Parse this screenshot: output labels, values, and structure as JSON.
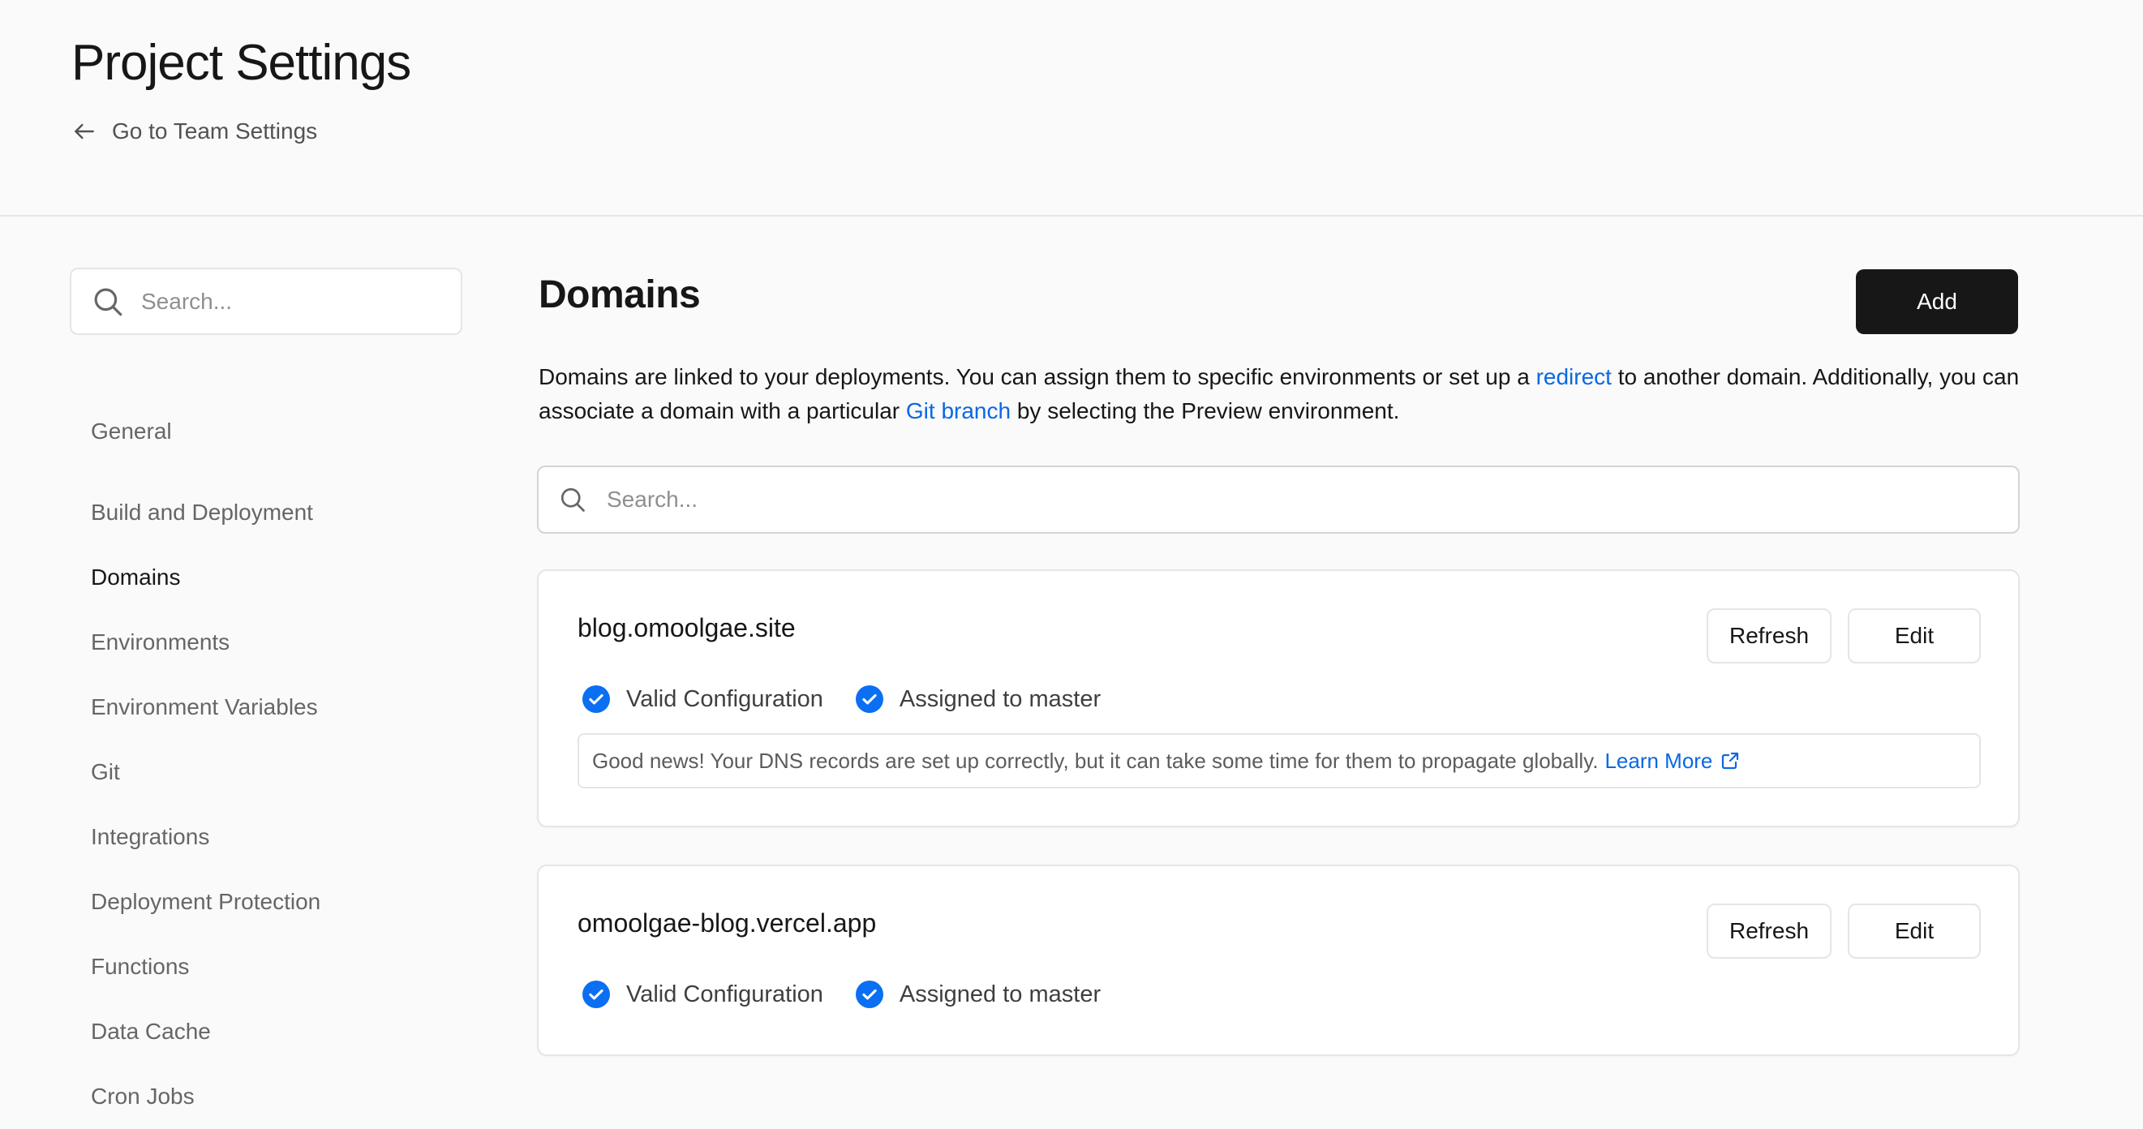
{
  "header": {
    "title": "Project Settings",
    "back_link": "Go to Team Settings"
  },
  "sidebar": {
    "search_placeholder": "Search...",
    "items": [
      {
        "label": "General"
      },
      {
        "label": "Build and Deployment"
      },
      {
        "label": "Domains",
        "active": true
      },
      {
        "label": "Environments"
      },
      {
        "label": "Environment Variables"
      },
      {
        "label": "Git"
      },
      {
        "label": "Integrations"
      },
      {
        "label": "Deployment Protection"
      },
      {
        "label": "Functions"
      },
      {
        "label": "Data Cache"
      },
      {
        "label": "Cron Jobs"
      }
    ]
  },
  "main": {
    "title": "Domains",
    "add_label": "Add",
    "description": {
      "part1": "Domains are linked to your deployments. You can assign them to specific environments or set up a ",
      "link1": "redirect",
      "part2": " to another domain. Additionally, you can associate a domain with a particular ",
      "link2": "Git branch",
      "part3": " by selecting the Preview environment."
    },
    "search_placeholder": "Search...",
    "domains": [
      {
        "name": "blog.omoolgae.site",
        "refresh_label": "Refresh",
        "edit_label": "Edit",
        "status_config": "Valid Configuration",
        "status_assigned": "Assigned to master",
        "note": "Good news! Your DNS records are set up correctly, but it can take some time for them to propagate globally.",
        "note_link": "Learn More"
      },
      {
        "name": "omoolgae-blog.vercel.app",
        "refresh_label": "Refresh",
        "edit_label": "Edit",
        "status_config": "Valid Configuration",
        "status_assigned": "Assigned to master"
      }
    ]
  },
  "colors": {
    "accent_link": "#0a68e3",
    "check_blue": "#0a6ff2",
    "primary_button": "#171717"
  }
}
